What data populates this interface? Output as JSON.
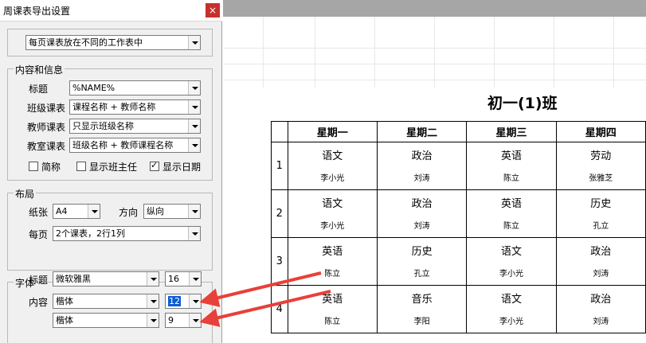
{
  "dialog": {
    "title": "周课表导出设置",
    "close_glyph": "×",
    "sheet_mode": "每页课表放在不同的工作表中",
    "content_group": {
      "legend": "内容和信息",
      "rows": [
        {
          "label": "标题",
          "value": "%NAME%"
        },
        {
          "label": "班级课表",
          "value": "课程名称 + 教师名称"
        },
        {
          "label": "教师课表",
          "value": "只显示班级名称"
        },
        {
          "label": "教室课表",
          "value": "班级名称 + 教师课程名称"
        }
      ],
      "checks": [
        {
          "label": "简称",
          "checked": false
        },
        {
          "label": "显示班主任",
          "checked": false
        },
        {
          "label": "显示日期",
          "checked": true
        }
      ]
    },
    "layout_group": {
      "legend": "布局",
      "paper_label": "纸张",
      "paper_value": "A4",
      "orient_label": "方向",
      "orient_value": "纵向",
      "perpage_label": "每页",
      "perpage_value": "2个课表，2行1列"
    },
    "font_group": {
      "legend": "字体",
      "title_label": "标题",
      "title_font": "微软雅黑",
      "title_size": "16",
      "content_label": "内容",
      "content_font": "楷体",
      "content_size": "12",
      "sub_font": "楷体",
      "sub_size": "9"
    }
  },
  "preview": {
    "title": "初一(1)班",
    "headers": [
      "星期一",
      "星期二",
      "星期三",
      "星期四"
    ],
    "rows": [
      {
        "index": "1",
        "cells": [
          {
            "subject": "语文",
            "teacher": "李小光"
          },
          {
            "subject": "政治",
            "teacher": "刘涛"
          },
          {
            "subject": "英语",
            "teacher": "陈立"
          },
          {
            "subject": "劳动",
            "teacher": "张雅芝"
          }
        ]
      },
      {
        "index": "2",
        "cells": [
          {
            "subject": "语文",
            "teacher": "李小光"
          },
          {
            "subject": "政治",
            "teacher": "刘涛"
          },
          {
            "subject": "英语",
            "teacher": "陈立"
          },
          {
            "subject": "历史",
            "teacher": "孔立"
          }
        ]
      },
      {
        "index": "3",
        "cells": [
          {
            "subject": "英语",
            "teacher": "陈立"
          },
          {
            "subject": "历史",
            "teacher": "孔立"
          },
          {
            "subject": "语文",
            "teacher": "李小光"
          },
          {
            "subject": "政治",
            "teacher": "刘涛"
          }
        ]
      },
      {
        "index": "4",
        "cells": [
          {
            "subject": "英语",
            "teacher": "陈立"
          },
          {
            "subject": "音乐",
            "teacher": "李阳"
          },
          {
            "subject": "语文",
            "teacher": "李小光"
          },
          {
            "subject": "政治",
            "teacher": "刘涛"
          }
        ]
      }
    ]
  },
  "colors": {
    "arrow": "#e8403a",
    "close_button": "#c9302c",
    "selection": "#0a5bd8"
  }
}
